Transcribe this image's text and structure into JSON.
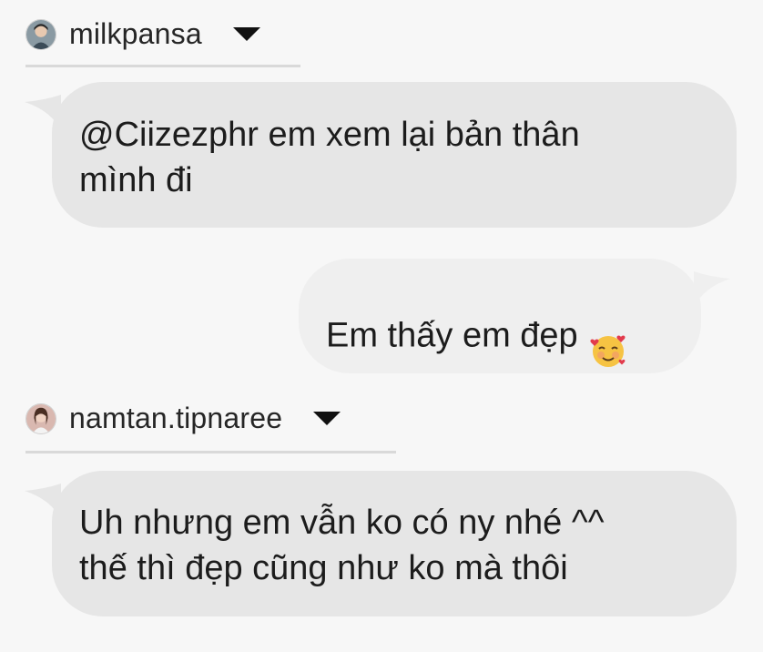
{
  "thread": {
    "users": [
      {
        "username": "milkpansa",
        "avatar": "avatar-milkpansa",
        "dropdown_icon": "caret-down-icon"
      },
      {
        "username": "namtan.tipnaree",
        "avatar": "avatar-namtan",
        "dropdown_icon": "caret-down-icon"
      }
    ],
    "messages": [
      {
        "side": "left",
        "text": "@Ciizezphr em xem lại bản thân\nmình đi"
      },
      {
        "side": "right",
        "text": "Em thấy em đẹp",
        "emoji": "smiling-face-with-hearts-icon"
      },
      {
        "side": "left",
        "text": "Uh nhưng em vẫn ko có ny nhé ^^\nthế thì đẹp cũng như ko mà thôi"
      }
    ]
  },
  "colors": {
    "background": "#f7f7f7",
    "incoming_bubble": "#e6e6e6",
    "outgoing_bubble": "#efefef",
    "divider": "#d9d9d9",
    "text": "#1c1c1c"
  }
}
